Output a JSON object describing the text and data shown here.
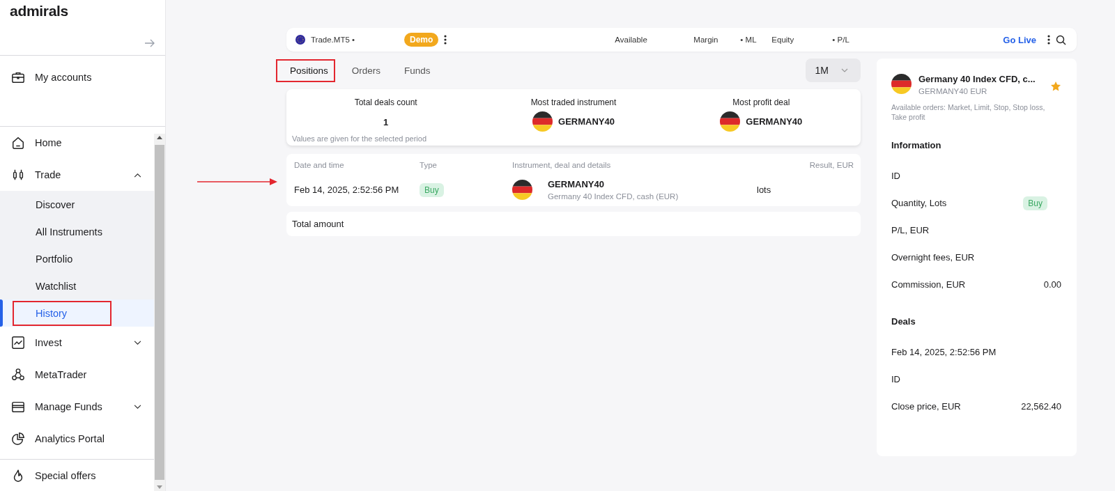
{
  "logo": "admirals",
  "sidebar": {
    "my_accounts": {
      "label": "My accounts"
    },
    "items": [
      {
        "label": "Home",
        "kind": "home",
        "selected": false
      },
      {
        "label": "Trade",
        "kind": "trade",
        "selected": false,
        "expanded": true,
        "children": [
          {
            "label": "Discover",
            "selected": false,
            "highlighted": false
          },
          {
            "label": "All Instruments",
            "selected": false,
            "highlighted": false
          },
          {
            "label": "Portfolio",
            "selected": false,
            "highlighted": false
          },
          {
            "label": "Watchlist",
            "selected": false,
            "highlighted": false
          },
          {
            "label": "History",
            "selected": true,
            "highlighted": true
          }
        ]
      },
      {
        "label": "Invest",
        "kind": "invest",
        "selected": false,
        "expanded": false
      },
      {
        "label": "MetaTrader",
        "kind": "metatrader",
        "selected": false
      },
      {
        "label": "Manage Funds",
        "kind": "funds",
        "selected": false,
        "expanded": false
      },
      {
        "label": "Analytics Portal",
        "kind": "analytics",
        "selected": false
      }
    ],
    "footer": {
      "label": "Special offers"
    }
  },
  "top_bar": {
    "account": "Trade.MT5 •",
    "badge": "Demo",
    "stats": [
      "Available",
      "Margin",
      "• ML",
      "Equity",
      "• P/L"
    ],
    "go_live": "Go Live"
  },
  "tabs": [
    {
      "label": "Positions",
      "selected": true,
      "highlighted": true
    },
    {
      "label": "Orders",
      "selected": false,
      "highlighted": false
    },
    {
      "label": "Funds",
      "selected": false,
      "highlighted": false
    }
  ],
  "period": "1M",
  "summary": {
    "blocks": [
      {
        "kind": "count",
        "title": "Total deals count",
        "value": "1"
      },
      {
        "kind": "instrument",
        "title": "Most traded instrument",
        "value": "GERMANY40"
      },
      {
        "kind": "instrument",
        "title": "Most profit deal",
        "value": "GERMANY40"
      }
    ],
    "note": "Values are given for the selected period"
  },
  "table": {
    "columns": [
      "Date and time",
      "Type",
      "Instrument, deal and details",
      "Result, EUR"
    ],
    "rows": [
      {
        "date": "Feb 14, 2025, 2:52:56 PM",
        "type": "Buy",
        "symbol": "GERMANY40",
        "description": "Germany 40 Index CFD, cash (EUR)",
        "quantity": "lots",
        "selected": false
      }
    ]
  },
  "total": "Total amount",
  "details": {
    "title": "Germany 40 Index CFD, c...",
    "subtitle": "GERMANY40 EUR",
    "orders": "Available orders: Market, Limit, Stop, Stop loss, Take profit",
    "sections": [
      {
        "title": "Information",
        "rows": [
          {
            "label": "ID"
          },
          {
            "label": "Quantity, Lots",
            "badge": "Buy"
          },
          {
            "label": "P/L, EUR"
          },
          {
            "label": "Overnight fees, EUR"
          },
          {
            "label": "Commission, EUR",
            "value": "0.00"
          }
        ]
      },
      {
        "title": "Deals",
        "rows": [
          {
            "label": "Feb 14, 2025, 2:52:56 PM"
          },
          {
            "label": "ID"
          },
          {
            "label": "Close price, EUR",
            "value": "22,562.40"
          }
        ]
      }
    ]
  }
}
